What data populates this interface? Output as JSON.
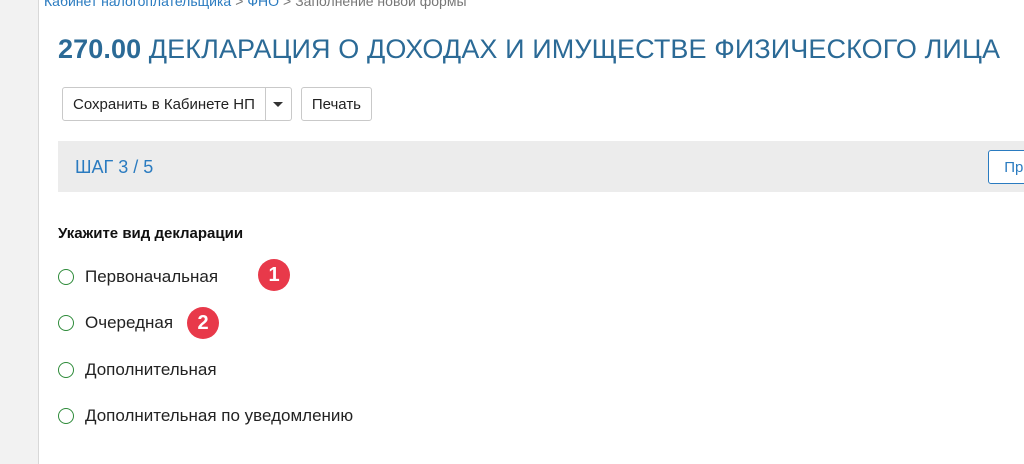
{
  "breadcrumb": {
    "items": [
      "Кабинет налогоплательщика",
      "ФНО",
      "Заполнение новой формы"
    ],
    "separator": ">"
  },
  "page": {
    "form_code": "270.00",
    "form_title": "ДЕКЛАРАЦИЯ О ДОХОДАХ И ИМУЩЕСТВЕ ФИЗИЧЕСКОГО ЛИЦА"
  },
  "toolbar": {
    "save_label": "Сохранить в Кабинете НП",
    "print_label": "Печать"
  },
  "step": {
    "label": "ШАГ 3 / 5",
    "next_label": "Про"
  },
  "declaration_type": {
    "question": "Укажите вид декларации",
    "options": [
      "Первоначальная",
      "Очередная",
      "Дополнительная",
      "Дополнительная по уведомлению"
    ]
  },
  "badges": [
    "1",
    "2"
  ],
  "colors": {
    "accent": "#2a7bc0",
    "title": "#2b6a96",
    "radio_border": "#2e8b3a",
    "badge": "#e8394a"
  }
}
